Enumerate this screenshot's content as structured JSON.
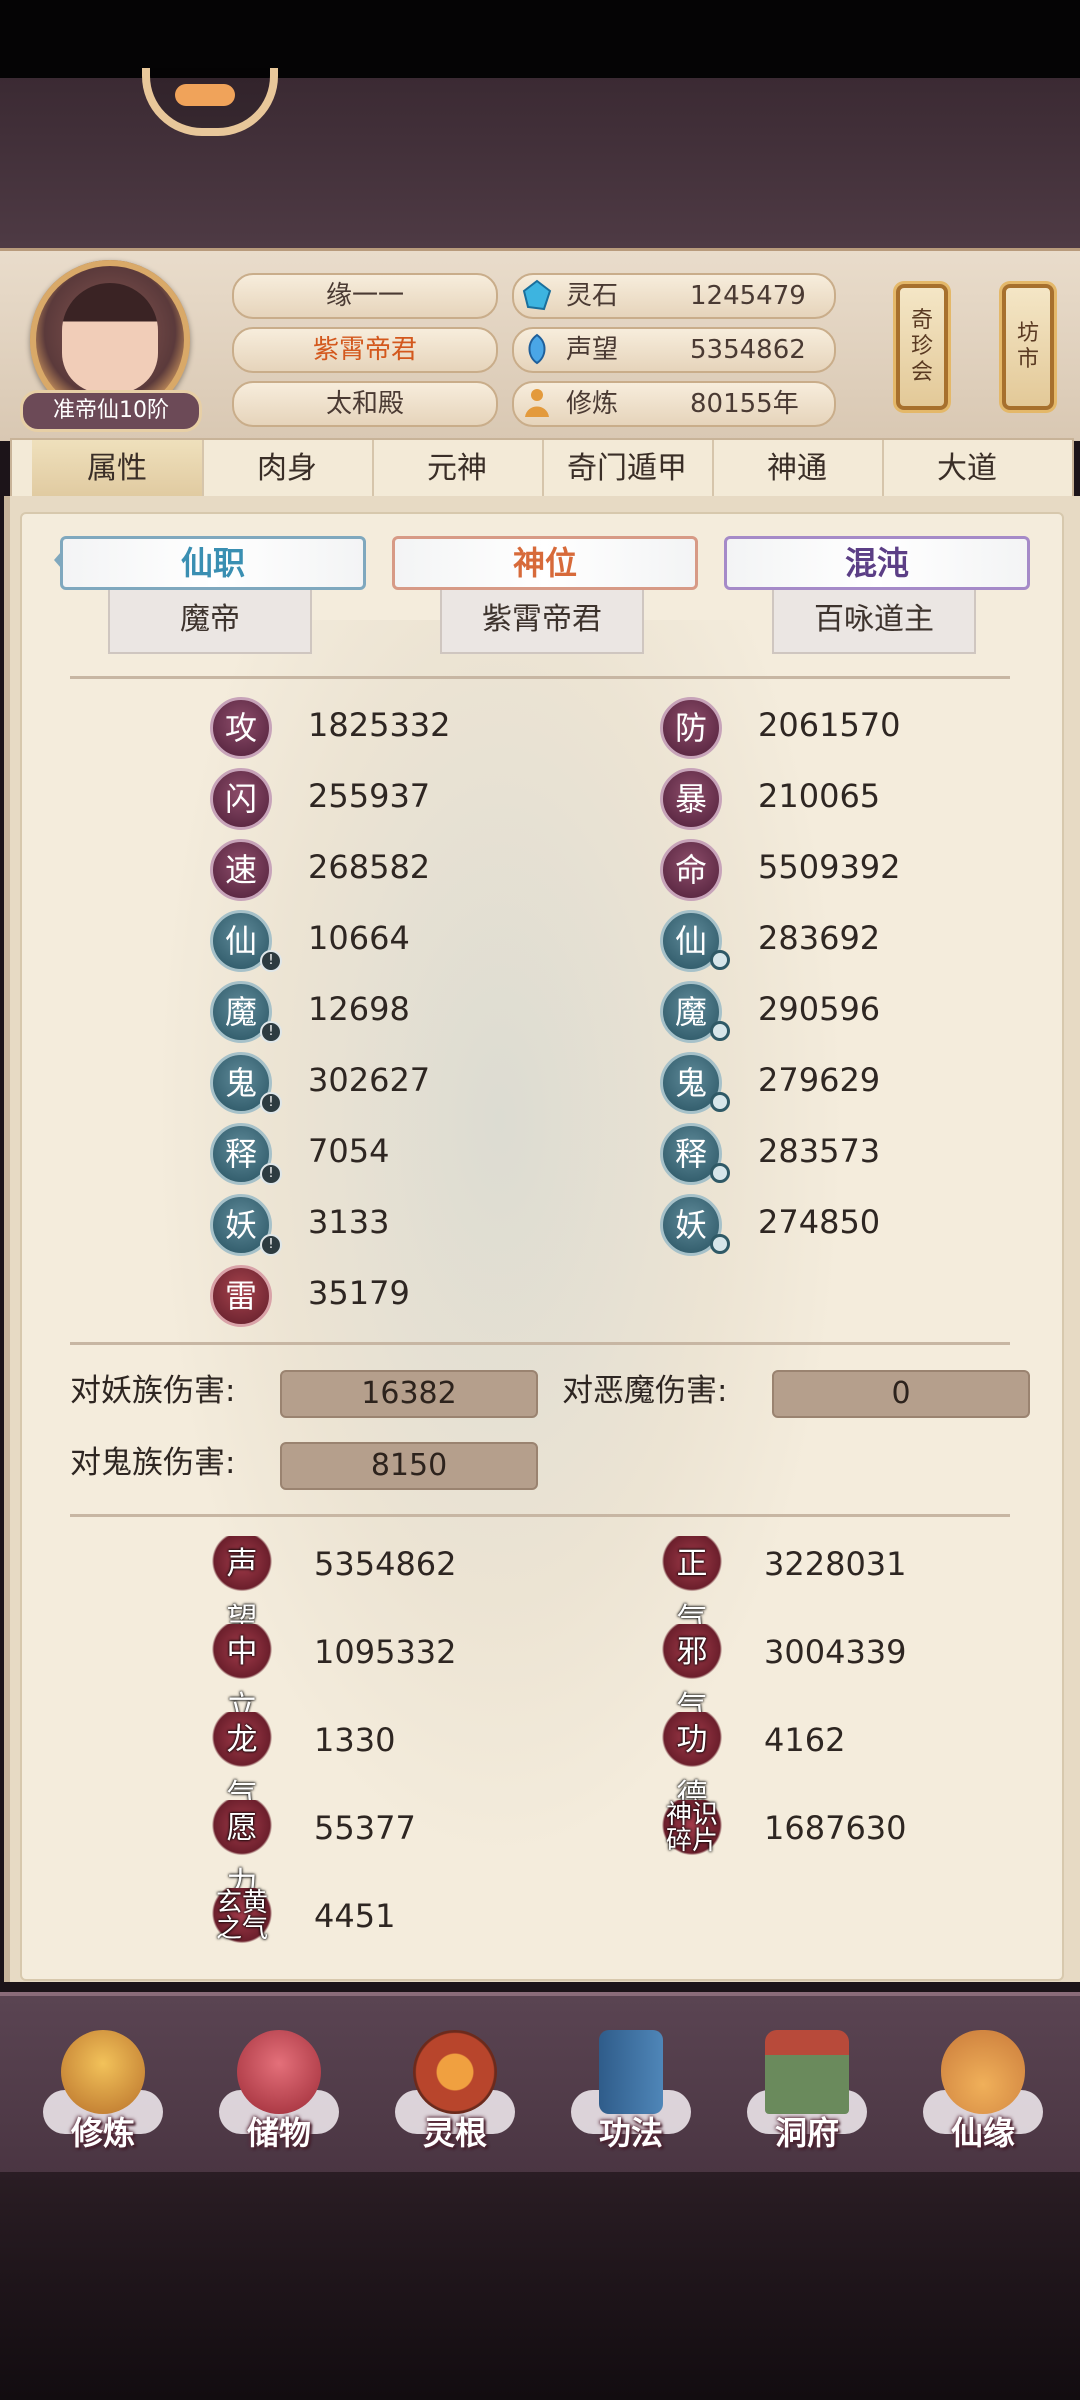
{
  "header": {
    "rank_badge": "准帝仙10阶",
    "names": [
      "缘一一",
      "紫霄帝君",
      "太和殿"
    ],
    "resources": [
      {
        "label": "灵石",
        "value": "1245479",
        "icon": "spirit-stone-icon"
      },
      {
        "label": "声望",
        "value": "5354862",
        "icon": "feather-icon"
      },
      {
        "label": "修炼",
        "value": "80155年",
        "icon": "meditation-icon"
      }
    ],
    "buttons": [
      {
        "label": [
          "奇",
          "珍",
          "会"
        ]
      },
      {
        "label": [
          "坊",
          "市"
        ]
      }
    ]
  },
  "tabs": [
    "属性",
    "肉身",
    "元神",
    "奇门遁甲",
    "神通",
    "大道"
  ],
  "active_tab": "属性",
  "ranks": [
    {
      "title": "仙职",
      "value": "魔帝",
      "color": "#3a8fb2"
    },
    {
      "title": "神位",
      "value": "紫霄帝君",
      "color": "#d76a3a"
    },
    {
      "title": "混沌",
      "value": "百咏道主",
      "color": "#5c3f86"
    }
  ],
  "stats_left": [
    {
      "icon": "攻",
      "value": "1825332"
    },
    {
      "icon": "闪",
      "value": "255937"
    },
    {
      "icon": "速",
      "value": "268582"
    },
    {
      "icon": "仙",
      "value": "10664"
    },
    {
      "icon": "魔",
      "value": "12698"
    },
    {
      "icon": "鬼",
      "value": "302627"
    },
    {
      "icon": "释",
      "value": "7054"
    },
    {
      "icon": "妖",
      "value": "3133"
    },
    {
      "icon": "雷",
      "value": "35179"
    }
  ],
  "stats_right": [
    {
      "icon": "防",
      "value": "2061570"
    },
    {
      "icon": "暴",
      "value": "210065"
    },
    {
      "icon": "命",
      "value": "5509392"
    },
    {
      "icon": "仙",
      "value": "283692"
    },
    {
      "icon": "魔",
      "value": "290596"
    },
    {
      "icon": "鬼",
      "value": "279629"
    },
    {
      "icon": "释",
      "value": "283573"
    },
    {
      "icon": "妖",
      "value": "274850"
    }
  ],
  "badge_glyph": "!",
  "damage": [
    {
      "label": "对妖族伤害:",
      "value": "16382"
    },
    {
      "label": "对恶魔伤害:",
      "value": "0"
    },
    {
      "label": "对鬼族伤害:",
      "value": "8150"
    }
  ],
  "misc": [
    {
      "icon": "声望",
      "value": "5354862"
    },
    {
      "icon": "正气",
      "value": "3228031"
    },
    {
      "icon": "中立",
      "value": "1095332"
    },
    {
      "icon": "邪气",
      "value": "3004339"
    },
    {
      "icon": "龙气",
      "value": "1330"
    },
    {
      "icon": "功德",
      "value": "4162"
    },
    {
      "icon": "愿力",
      "value": "55377"
    },
    {
      "icon": "神识碎片",
      "icon_lines": [
        "神识",
        "碎片"
      ],
      "value": "1687630"
    },
    {
      "icon": "玄黄之气",
      "icon_lines": [
        "玄黄",
        "之气"
      ],
      "value": "4451"
    }
  ],
  "nav": [
    {
      "label": "修炼",
      "icon": "cultivate-icon",
      "color": "#d99a3a"
    },
    {
      "label": "储物",
      "icon": "storage-bag-icon",
      "color": "#c2454f"
    },
    {
      "label": "灵根",
      "icon": "spirit-root-icon",
      "color": "#b8452c"
    },
    {
      "label": "功法",
      "icon": "technique-book-icon",
      "color": "#3b6c9c"
    },
    {
      "label": "洞府",
      "icon": "cave-mansion-icon",
      "color": "#6a8a5c"
    },
    {
      "label": "仙缘",
      "icon": "gourd-icon",
      "color": "#c97a3a"
    }
  ]
}
